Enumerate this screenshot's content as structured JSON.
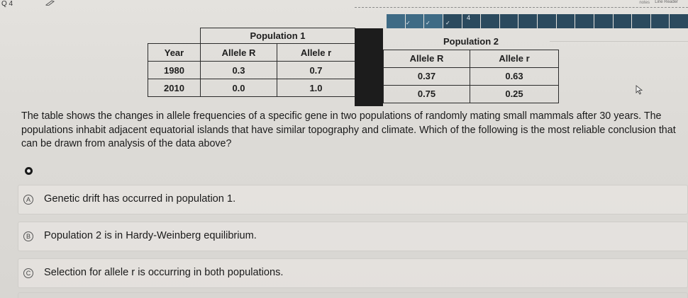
{
  "header": {
    "question_label": "Q 4",
    "question_number": "4",
    "notes_label": "notes",
    "reader_label": "Line Reader"
  },
  "progress": {
    "total_segments": 16,
    "completed_segments": 3
  },
  "table": {
    "population1_title": "Population 1",
    "population2_title": "Population 2",
    "columns": [
      "Year",
      "Allele R",
      "Allele r"
    ],
    "pop1_rows": [
      [
        "1980",
        "0.3",
        "0.7"
      ],
      [
        "2010",
        "0.0",
        "1.0"
      ]
    ],
    "pop2_columns": [
      "Allele R",
      "Allele r"
    ],
    "pop2_rows": [
      [
        "0.37",
        "0.63"
      ],
      [
        "0.75",
        "0.25"
      ]
    ]
  },
  "question": {
    "text": "The table shows the changes in allele frequencies of a specific gene in two populations of randomly mating small mammals after 30 years. The populations inhabit adjacent equatorial islands that have similar topography and climate. Which of the following is the most reliable conclusion that can be drawn from analysis of the data above?"
  },
  "options": [
    {
      "letter": "A",
      "text": "Genetic drift has occurred in population 1."
    },
    {
      "letter": "B",
      "text": "Population 2 is in Hardy-Weinberg equilibrium."
    },
    {
      "letter": "C",
      "text": "Selection for allele r is occurring in both populations."
    }
  ]
}
